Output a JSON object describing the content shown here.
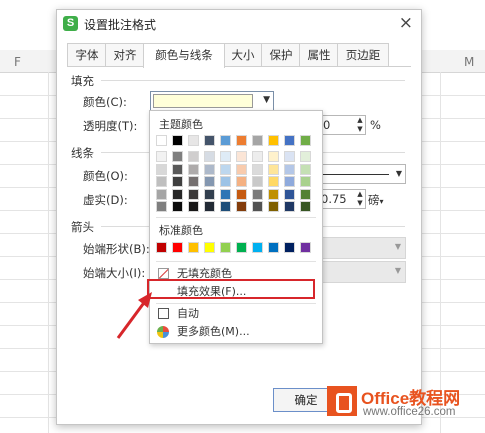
{
  "sheet": {
    "col_left": "F",
    "col_right": "M"
  },
  "dialog": {
    "title": "设置批注格式",
    "close_icon": "×",
    "tabs": [
      {
        "label": "字体"
      },
      {
        "label": "对齐"
      },
      {
        "label": "颜色与线条",
        "active": true
      },
      {
        "label": "大小"
      },
      {
        "label": "保护"
      },
      {
        "label": "属性"
      },
      {
        "label": "页边距"
      }
    ],
    "fill": {
      "section": "填充",
      "color_label": "颜色(C):",
      "color_value": "#ffffd9",
      "transparency_label": "透明度(T):",
      "transparency_value": "0",
      "transparency_unit": "%"
    },
    "line": {
      "section": "线条",
      "color_label": "颜色(O):",
      "dash_label": "虚实(D):",
      "weight_value": "0.75",
      "weight_unit": "磅"
    },
    "arrow": {
      "section": "箭头",
      "begin_style_label": "始端形状(B):",
      "begin_size_label": "始端大小(I):"
    },
    "ok_label": "确定"
  },
  "color_popup": {
    "theme_title": "主题颜色",
    "theme_top": [
      "#ffffff",
      "#000000",
      "#e7e6e6",
      "#44546a",
      "#5b9bd5",
      "#ed7d31",
      "#a5a5a5",
      "#ffc000",
      "#4472c4",
      "#70ad47"
    ],
    "theme_shades": [
      [
        "#f2f2f2",
        "#7f7f7f",
        "#d0cece",
        "#d6dce4",
        "#deebf6",
        "#fbe5d6",
        "#ededed",
        "#fff2cc",
        "#dae3f3",
        "#e2efda"
      ],
      [
        "#d8d8d8",
        "#595959",
        "#aeabab",
        "#adb9ca",
        "#bdd7ee",
        "#f8cbad",
        "#dbdbdb",
        "#fee599",
        "#b4c7e7",
        "#c5e0b4"
      ],
      [
        "#bfbfbf",
        "#3f3f3f",
        "#757070",
        "#8497b0",
        "#9dc3e6",
        "#f4b183",
        "#c9c9c9",
        "#ffd966",
        "#8faadc",
        "#a9d18e"
      ],
      [
        "#a5a5a5",
        "#262626",
        "#3a3838",
        "#323f4f",
        "#2e75b5",
        "#c55a11",
        "#7b7b7b",
        "#bf9000",
        "#2f5597",
        "#538135"
      ],
      [
        "#7f7f7f",
        "#0c0c0c",
        "#171616",
        "#222a35",
        "#1e4e79",
        "#833c0b",
        "#525252",
        "#7f6000",
        "#1f3864",
        "#375623"
      ]
    ],
    "standard_title": "标准颜色",
    "standard_colors": [
      "#c00000",
      "#ff0000",
      "#ffc000",
      "#ffff00",
      "#92d050",
      "#00b050",
      "#00b0f0",
      "#0070c0",
      "#002060",
      "#7030a0"
    ],
    "no_fill_label": "无填充颜色",
    "fill_effect_label": "填充效果(F)...",
    "auto_label": "自动",
    "more_colors_label": "更多颜色(M)...",
    "highlight_color": "#d7262b"
  },
  "watermark": {
    "brand": "Office教程网",
    "url": "www.office26.com"
  }
}
